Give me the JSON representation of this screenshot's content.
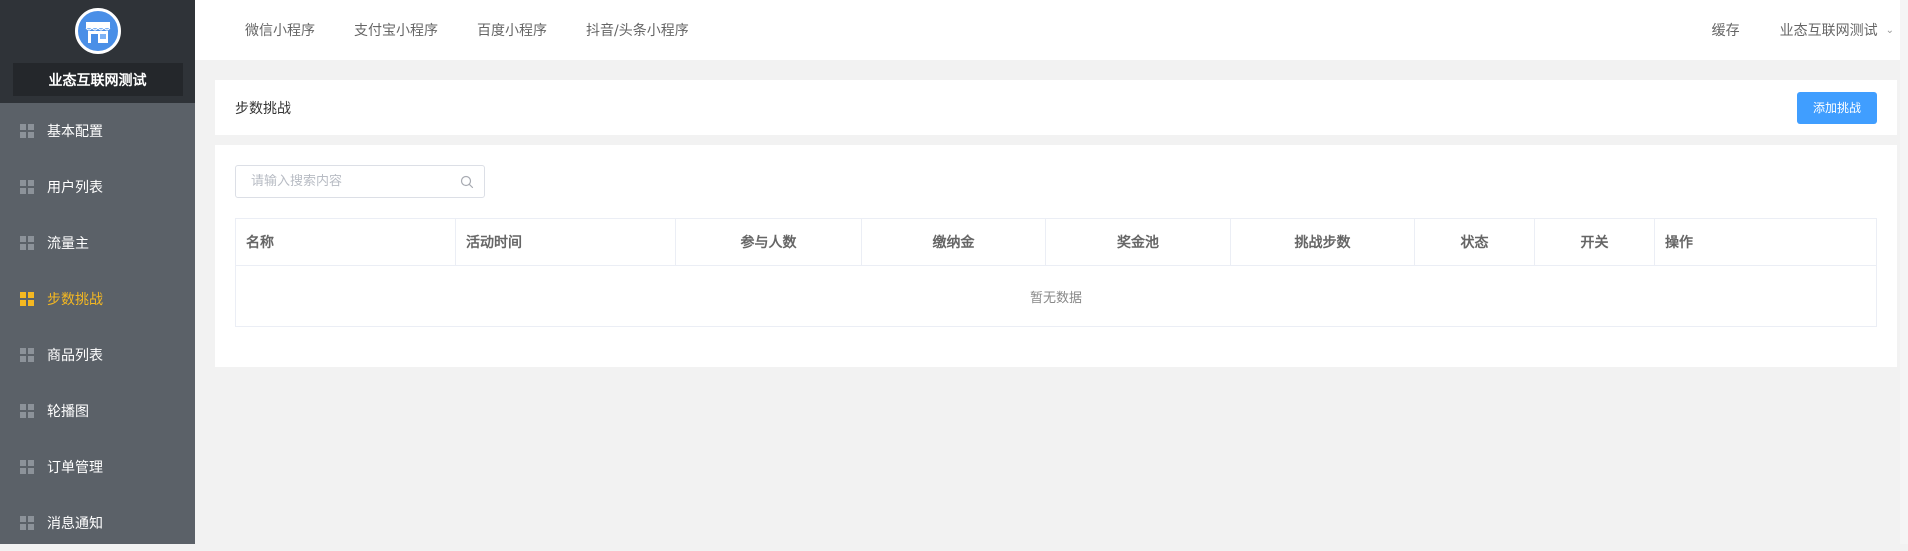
{
  "sidebar": {
    "brand_name": "业态互联网测试",
    "items": [
      {
        "label": "基本配置",
        "active": false
      },
      {
        "label": "用户列表",
        "active": false
      },
      {
        "label": "流量主",
        "active": false
      },
      {
        "label": "步数挑战",
        "active": true
      },
      {
        "label": "商品列表",
        "active": false
      },
      {
        "label": "轮播图",
        "active": false
      },
      {
        "label": "订单管理",
        "active": false
      },
      {
        "label": "消息通知",
        "active": false
      }
    ]
  },
  "header": {
    "nav": [
      "微信小程序",
      "支付宝小程序",
      "百度小程序",
      "抖音/头条小程序"
    ],
    "cache_label": "缓存",
    "user_label": "业态互联网测试"
  },
  "page": {
    "title": "步数挑战",
    "add_button_label": "添加挑战"
  },
  "search": {
    "placeholder": "请输入搜索内容",
    "value": ""
  },
  "table": {
    "columns": [
      "名称",
      "活动时间",
      "参与人数",
      "缴纳金",
      "奖金池",
      "挑战步数",
      "状态",
      "开关",
      "操作"
    ],
    "empty_text": "暂无数据"
  },
  "colors": {
    "sidebar_bg": "#5b6168",
    "brand_bg": "#2f3338",
    "active": "#f5b821",
    "primary": "#409eff"
  }
}
